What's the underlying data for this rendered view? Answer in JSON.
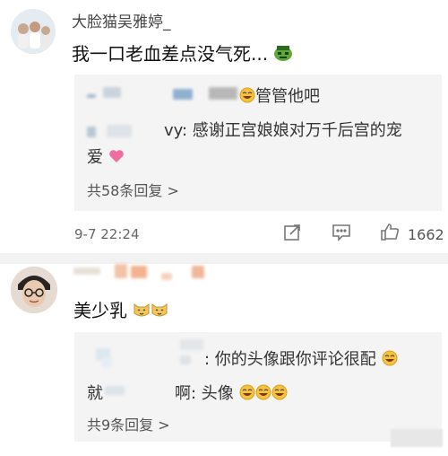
{
  "comment1": {
    "username": "大脸猫吴雅婷_",
    "text": "我一口老血差点没气死...",
    "reply_line1_suffix": "管管他吧",
    "reply_line2_prefix": "vy:",
    "reply_line2_text": "感谢正宫娘娘对万千后宫的宠",
    "reply_line3_text": "爱",
    "more_replies": "共58条回复 >",
    "timestamp": "9-7 22:24",
    "like_count": "1662"
  },
  "comment2": {
    "text": "美少乳",
    "reply_line1": ": 你的头像跟你评论很配",
    "reply_line2_prefix": "就",
    "reply_line2_text": "啊: 头像",
    "more_replies": "共9条回复 >"
  }
}
